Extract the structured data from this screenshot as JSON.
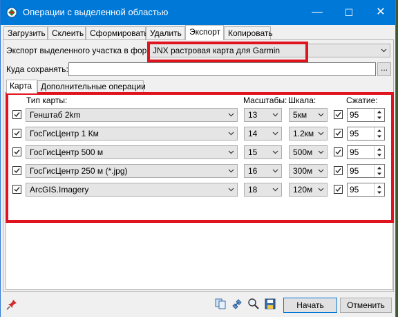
{
  "window": {
    "title": "Операции с выделенной областью",
    "minimize": "—",
    "maximize": "☐",
    "close": "✕"
  },
  "tabs": [
    "Загрузить",
    "Склеить",
    "Сформировать",
    "Удалить",
    "Экспорт",
    "Копировать"
  ],
  "export_format": {
    "label": "Экспорт выделенного участка в формат",
    "value": "JNX растровая карта для Garmin"
  },
  "save_to": {
    "label": "Куда сохранять:",
    "value": "",
    "browse_label": "..."
  },
  "subtabs": [
    "Карта",
    "Дополнительные операции"
  ],
  "columns": {
    "map_type": "Тип карты:",
    "zooms": "Масштабы:",
    "scale": "Шкала:",
    "compression": "Сжатие:"
  },
  "rows": [
    {
      "map": "Генштаб 2km",
      "zoom": "13",
      "scale": "5км",
      "compression": "95"
    },
    {
      "map": "ГосГисЦентр 1 Км",
      "zoom": "14",
      "scale": "1.2км",
      "compression": "95"
    },
    {
      "map": "ГосГисЦентр 500 м",
      "zoom": "15",
      "scale": "500м",
      "compression": "95"
    },
    {
      "map": "ГосГисЦентр 250 м (*.jpg)",
      "zoom": "16",
      "scale": "300м",
      "compression": "95"
    },
    {
      "map": "ArcGIS.Imagery",
      "zoom": "18",
      "scale": "120м",
      "compression": "95"
    }
  ],
  "buttons": {
    "start": "Начать",
    "cancel": "Отменить"
  },
  "colors": {
    "titlebar": "#0078d7",
    "highlight": "#e0141e"
  }
}
